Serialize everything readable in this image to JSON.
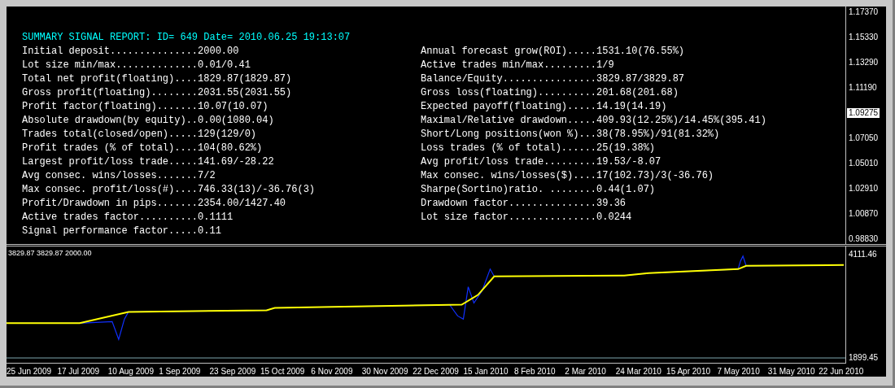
{
  "report": {
    "title": "SUMMARY SIGNAL REPORT: ID= 649 Date= 2010.06.25 19:13:07",
    "left_rows": [
      "Initial deposit...............2000.00",
      "Lot size min/max..............0.01/0.41",
      "Total net profit(floating)....1829.87(1829.87)",
      "Gross profit(floating)........2031.55(2031.55)",
      "Profit factor(floating).......10.07(10.07)",
      "Absolute drawdown(by equity)..0.00(1080.04)",
      "Trades total(closed/open).....129(129/0)",
      "Profit trades (% of total)....104(80.62%)",
      "Largest profit/loss trade.....141.69/-28.22",
      "Avg consec. wins/losses.......7/2",
      "Max consec. profit/loss(#)....746.33(13)/-36.76(3)",
      "Profit/Drawdown in pips.......2354.00/1427.40",
      "Active trades factor..........0.1111",
      "Signal performance factor.....0.11"
    ],
    "right_rows": [
      "Annual forecast grow(ROI).....1531.10(76.55%)",
      "Active trades min/max.........1/9",
      "Balance/Equity................3829.87/3829.87",
      "Gross loss(floating)..........201.68(201.68)",
      "Expected payoff(floating).....14.19(14.19)",
      "Maximal/Relative drawdown.....409.93(12.25%)/14.45%(395.41)",
      "Short/Long positions(won %)...38(78.95%)/91(81.32%)",
      "Loss trades (% of total)......25(19.38%)",
      "Avg profit/loss trade.........19.53/-8.07",
      "Max consec. wins/losses($)....17(102.73)/3(-36.76)",
      "Sharpe(Sortino)ratio. ........0.44(1.07)",
      "Drawdown factor...............39.36",
      "Lot size factor...............0.0244"
    ]
  },
  "price_axis": {
    "labels": [
      "1.17370",
      "1.15330",
      "1.13290",
      "1.11190",
      "1.07050",
      "1.05010",
      "1.02910",
      "1.00870",
      "0.98830"
    ],
    "current_price": "1.09275"
  },
  "equity_panel": {
    "header": "3829.87 3829.87 2000.00",
    "scale_max": "4111.46",
    "scale_min": "1899.45"
  },
  "date_axis": [
    "25 Jun 2009",
    "17 Jul 2009",
    "10 Aug 2009",
    "1 Sep 2009",
    "23 Sep 2009",
    "15 Oct 2009",
    "6 Nov 2009",
    "30 Nov 2009",
    "22 Dec 2009",
    "15 Jan 2010",
    "8 Feb 2010",
    "2 Mar 2010",
    "24 Mar 2010",
    "15 Apr 2010",
    "7 May 2010",
    "31 May 2010",
    "22 Jun 2010"
  ]
}
